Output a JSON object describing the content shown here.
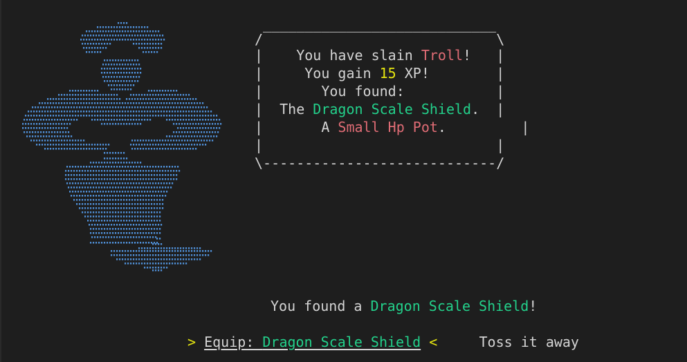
{
  "colors": {
    "background": "#1e1e1e",
    "text": "#d4d4d4",
    "enemy": "#e06c75",
    "xp": "#e5e510",
    "item": "#23d18b",
    "potion": "#e06c75",
    "art": "#4f8fd6",
    "selector": "#e5e510"
  },
  "art": {
    "name": "genie-lamp-ascii-art"
  },
  "box": {
    "top": " ____________________________",
    "edge_top": "/                            \\",
    "line1_a": "|    You have slain ",
    "enemy": "Troll",
    "line1_b": "!   |",
    "line2_a": "|     You gain ",
    "xp": "15",
    "line2_b": " XP!        |",
    "line3": "|       You found:           |",
    "line4_a": "|  The ",
    "item": "Dragon Scale Shield",
    "line4_b": ".  |",
    "line5_a": "|       A ",
    "potion": "Small Hp Pot",
    "line5_b": ".         |",
    "line6": "|                            |",
    "edge_bottom": "\\----------------------------/"
  },
  "found": {
    "prefix": "You found a ",
    "item": "Dragon Scale Shield",
    "suffix": "!"
  },
  "menu": {
    "left_arrow": ">",
    "option1_label": "Equip: ",
    "option1_item": "Dragon Scale Shield",
    "right_arrow": "<",
    "spacer": "     ",
    "option2_label": "Toss it away"
  }
}
